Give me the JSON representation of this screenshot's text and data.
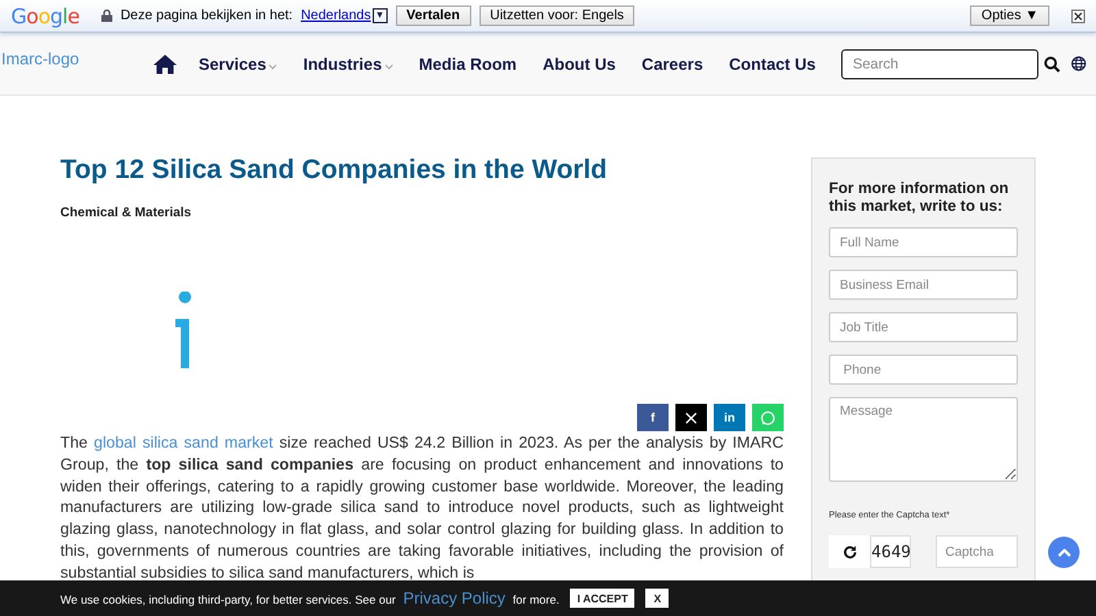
{
  "translate_bar": {
    "brand": "Google",
    "prompt": "Deze pagina bekijken in het:",
    "language": "Nederlands",
    "dropdown": "▼",
    "translate_button": "Vertalen",
    "disable_button": "Uitzetten voor: Engels",
    "options_button": "Opties ▼"
  },
  "nav": {
    "logo_alt": "Imarc-logo",
    "items": [
      {
        "label": "Services",
        "dropdown": true
      },
      {
        "label": "Industries",
        "dropdown": true
      },
      {
        "label": "Media Room",
        "dropdown": false
      },
      {
        "label": "About Us",
        "dropdown": false
      },
      {
        "label": "Careers",
        "dropdown": false
      },
      {
        "label": "Contact Us",
        "dropdown": false
      }
    ],
    "search": {
      "placeholder": "Search"
    }
  },
  "article": {
    "title": "Top 12 Silica Sand Companies in the World",
    "category": "Chemical & Materials",
    "share": [
      {
        "kind": "facebook",
        "glyph": "f"
      },
      {
        "kind": "x"
      },
      {
        "kind": "linkedin",
        "glyph": "in"
      },
      {
        "kind": "whatsapp"
      }
    ],
    "paragraph": {
      "before": "The",
      "link": "global silica sand market",
      "after": "size reached US$ 24.2 Billion in 2023. As per the analysis by IMARC Group, the **top silica sand companies** are focusing on product enhancement and innovations to widen their offerings, catering to a rapidly growing customer base worldwide. Moreover, the leading manufacturers are utilizing low-grade silica sand to introduce novel products, such as lightweight glazing glass, nanotechnology in flat glass, and solar control glazing for building glass. In addition to this, governments of numerous countries are taking favorable initiatives, including the provision of substantial subsidies to silica sand manufacturers, which is"
    }
  },
  "sidebar": {
    "heading": "For more information on this market, write to us:",
    "fields": [
      {
        "kind": "input",
        "placeholder": "Full Name"
      },
      {
        "kind": "input",
        "placeholder": "Business Email"
      },
      {
        "kind": "input",
        "placeholder": "Job Title"
      },
      {
        "kind": "input",
        "placeholder": " Phone"
      },
      {
        "kind": "textarea",
        "placeholder": "Message"
      }
    ],
    "captcha_label": "Please enter the Captcha text*",
    "captcha_code": "4649",
    "captcha_field": {
      "placeholder": "Captcha"
    }
  },
  "cookie_bar": {
    "before": "We use cookies, including third-party, for better services. See our",
    "link": "Privacy Policy",
    "after": "for more.",
    "accept": "I ACCEPT",
    "close": "X"
  }
}
